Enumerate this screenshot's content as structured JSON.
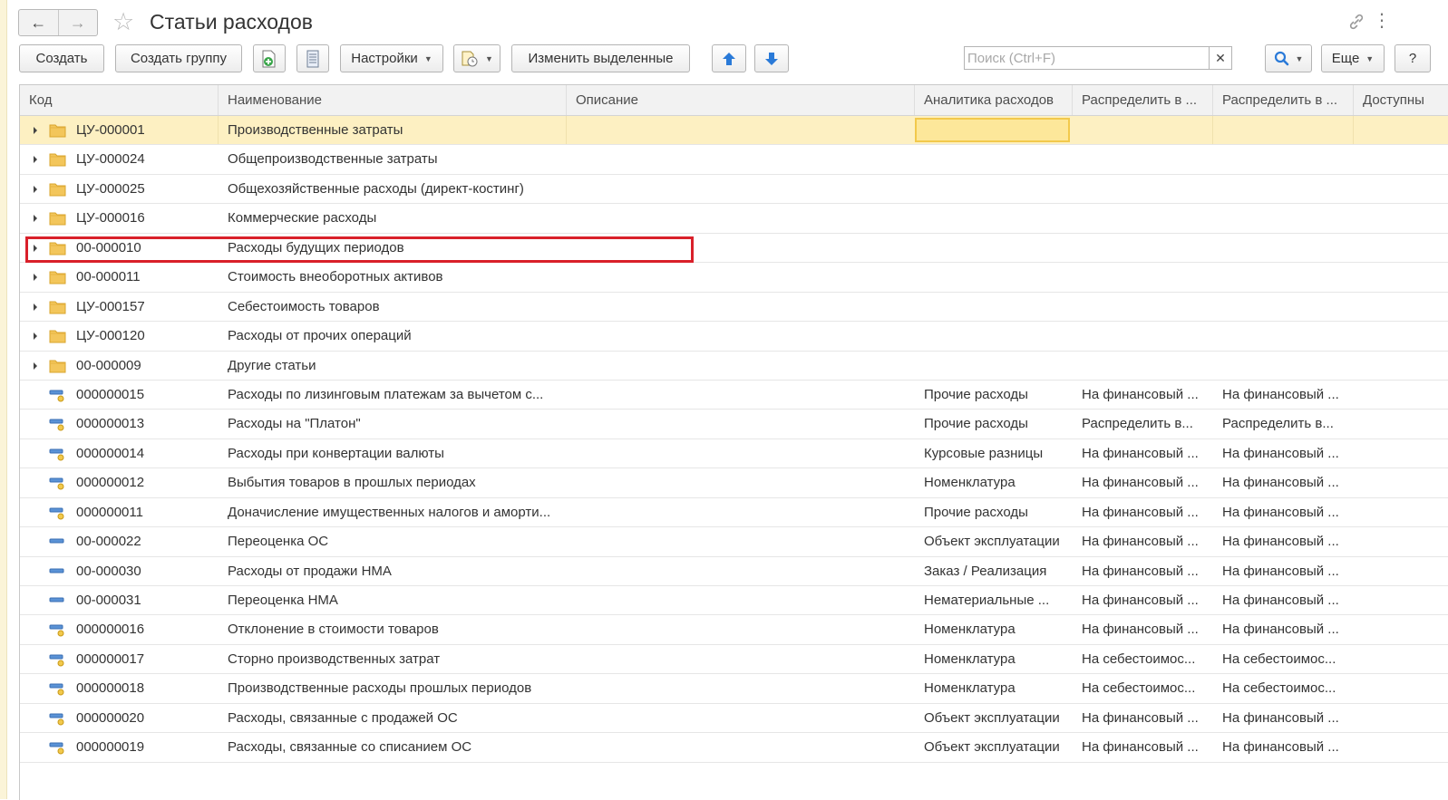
{
  "window": {
    "title": "Статьи расходов"
  },
  "toolbar": {
    "create": "Создать",
    "create_group": "Создать группу",
    "settings": "Настройки",
    "change_selected": "Изменить выделенные",
    "more": "Еще",
    "help": "?",
    "search_placeholder": "Поиск (Ctrl+F)",
    "search_value": ""
  },
  "columns": [
    "Код",
    "Наименование",
    "Описание",
    "Аналитика расходов",
    "Распределить в ...",
    "Распределить в ...",
    "Доступны"
  ],
  "rows": [
    {
      "icon": "folder",
      "code": "ЦУ-000001",
      "name": "Производственные затраты",
      "desc": "",
      "analytics": "",
      "dist1": "",
      "dist2": "",
      "selected": true
    },
    {
      "icon": "folder",
      "code": "ЦУ-000024",
      "name": "Общепроизводственные затраты",
      "desc": "",
      "analytics": "",
      "dist1": "",
      "dist2": ""
    },
    {
      "icon": "folder",
      "code": "ЦУ-000025",
      "name": "Общехозяйственные расходы (директ-костинг)",
      "desc": "",
      "analytics": "",
      "dist1": "",
      "dist2": ""
    },
    {
      "icon": "folder",
      "code": "ЦУ-000016",
      "name": "Коммерческие расходы",
      "desc": "",
      "analytics": "",
      "dist1": "",
      "dist2": ""
    },
    {
      "icon": "folder",
      "code": "00-000010",
      "name": "Расходы будущих периодов",
      "desc": "",
      "analytics": "",
      "dist1": "",
      "dist2": "",
      "highlighted": true
    },
    {
      "icon": "folder",
      "code": "00-000011",
      "name": "Стоимость внеоборотных активов",
      "desc": "",
      "analytics": "",
      "dist1": "",
      "dist2": ""
    },
    {
      "icon": "folder",
      "code": "ЦУ-000157",
      "name": "Себестоимость товаров",
      "desc": "",
      "analytics": "",
      "dist1": "",
      "dist2": ""
    },
    {
      "icon": "folder",
      "code": "ЦУ-000120",
      "name": "Расходы от прочих операций",
      "desc": "",
      "analytics": "",
      "dist1": "",
      "dist2": ""
    },
    {
      "icon": "folder",
      "code": "00-000009",
      "name": "Другие статьи",
      "desc": "",
      "analytics": "",
      "dist1": "",
      "dist2": ""
    },
    {
      "icon": "item-key",
      "code": "000000015",
      "name": "Расходы по лизинговым платежам за вычетом с...",
      "desc": "",
      "analytics": "Прочие расходы",
      "dist1": "На финансовый ...",
      "dist2": "На финансовый ..."
    },
    {
      "icon": "item-key",
      "code": "000000013",
      "name": "Расходы на \"Платон\"",
      "desc": "",
      "analytics": "Прочие расходы",
      "dist1": "Распределить в...",
      "dist2": "Распределить в..."
    },
    {
      "icon": "item-key",
      "code": "000000014",
      "name": "Расходы при конвертации валюты",
      "desc": "",
      "analytics": "Курсовые разницы",
      "dist1": "На финансовый ...",
      "dist2": "На финансовый ..."
    },
    {
      "icon": "item-key",
      "code": "000000012",
      "name": "Выбытия товаров в прошлых периодах",
      "desc": "",
      "analytics": "Номенклатура",
      "dist1": "На финансовый ...",
      "dist2": "На финансовый ..."
    },
    {
      "icon": "item-key",
      "code": "000000011",
      "name": "Доначисление имущественных налогов и аморти...",
      "desc": "",
      "analytics": "Прочие расходы",
      "dist1": "На финансовый ...",
      "dist2": "На финансовый ..."
    },
    {
      "icon": "item",
      "code": "00-000022",
      "name": "Переоценка ОС",
      "desc": "",
      "analytics": "Объект эксплуатации",
      "dist1": "На финансовый ...",
      "dist2": "На финансовый ..."
    },
    {
      "icon": "item",
      "code": "00-000030",
      "name": "Расходы от продажи НМА",
      "desc": "",
      "analytics": "Заказ / Реализация",
      "dist1": "На финансовый ...",
      "dist2": "На финансовый ..."
    },
    {
      "icon": "item",
      "code": "00-000031",
      "name": "Переоценка НМА",
      "desc": "",
      "analytics": "Нематериальные ...",
      "dist1": "На финансовый ...",
      "dist2": "На финансовый ..."
    },
    {
      "icon": "item-key",
      "code": "000000016",
      "name": "Отклонение в стоимости товаров",
      "desc": "",
      "analytics": "Номенклатура",
      "dist1": "На финансовый ...",
      "dist2": "На финансовый ..."
    },
    {
      "icon": "item-key",
      "code": "000000017",
      "name": "Сторно производственных затрат",
      "desc": "",
      "analytics": "Номенклатура",
      "dist1": "На себестоимос...",
      "dist2": "На себестоимос..."
    },
    {
      "icon": "item-key",
      "code": "000000018",
      "name": "Производственные расходы прошлых периодов",
      "desc": "",
      "analytics": "Номенклатура",
      "dist1": "На себестоимос...",
      "dist2": "На себестоимос..."
    },
    {
      "icon": "item-key",
      "code": "000000020",
      "name": "Расходы, связанные с продажей ОС",
      "desc": "",
      "analytics": "Объект эксплуатации",
      "dist1": "На финансовый ...",
      "dist2": "На финансовый ..."
    },
    {
      "icon": "item-key",
      "code": "000000019",
      "name": "Расходы, связанные со списанием ОС",
      "desc": "",
      "analytics": "Объект эксплуатации",
      "dist1": "На финансовый ...",
      "dist2": "На финансовый ..."
    }
  ],
  "colors": {
    "selected_row": "#fdf0c2",
    "focus_cell": "#f2c94c",
    "highlight_frame": "#d9202a",
    "folder": "#f3c65b",
    "accent_blue": "#2a7ad8"
  }
}
